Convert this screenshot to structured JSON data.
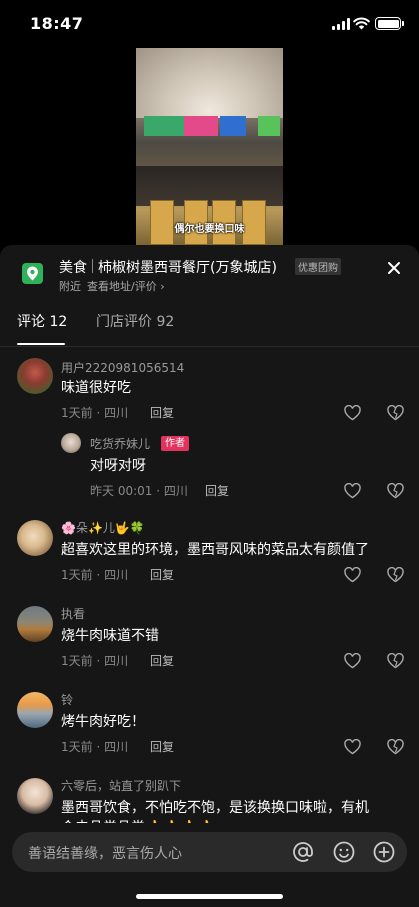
{
  "status_bar": {
    "time": "18:47"
  },
  "video": {
    "caption": "偶尔也要换口味"
  },
  "header": {
    "category": "美食",
    "shop_name": "柿椒树墨西哥餐厅(万象城店)",
    "tag": "优惠团购",
    "distance": "附近",
    "address_link": "查看地址/评价 ›"
  },
  "tabs": [
    {
      "label": "评论 12"
    },
    {
      "label": "门店评价 92"
    }
  ],
  "comments": [
    {
      "user": "用户2220981056514",
      "text": "味道很好吃",
      "meta": "1天前 · 四川",
      "reply_label": "回复",
      "sub_reply": {
        "user": "吃货乔妹儿",
        "badge": "作者",
        "text": "对呀对呀",
        "meta": "昨天 00:01 · 四川",
        "reply_label": "回复"
      }
    },
    {
      "user": "🌸朵✨儿🤟🍀",
      "text": "超喜欢这里的环境，墨西哥风味的菜品太有颜值了",
      "meta": "1天前 · 四川",
      "reply_label": "回复"
    },
    {
      "user": "执看",
      "text": "烧牛肉味道不错",
      "meta": "1天前 · 四川",
      "reply_label": "回复"
    },
    {
      "user": "铃",
      "text": "烤牛肉好吃！",
      "meta": "1天前 · 四川",
      "reply_label": "回复"
    },
    {
      "user": "六零后，站直了别趴下",
      "text": "墨西哥饮食，不怕吃不饱，是该换换口味啦，有机",
      "text2": "会去品尝品尝👍👍👍👍"
    }
  ],
  "input": {
    "placeholder": "善语结善缘，恶言伤人心"
  },
  "colors": {
    "sheet_bg": "#161616",
    "author_badge": "#e0345f",
    "location_icon": "#2fb15a"
  }
}
